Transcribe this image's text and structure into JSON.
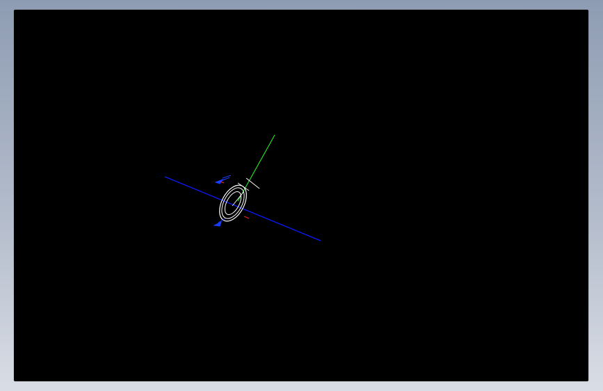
{
  "window": {
    "background_top": "#8e9cb3",
    "background_bottom": "#d9dde5"
  },
  "viewport": {
    "background": "#000000",
    "model": "part",
    "colors": {
      "axis_primary": "#0a1aff",
      "axis_secondary": "#22ff22",
      "geometry": "#ffffff",
      "dimension_arrow": "#1a3cff",
      "hidden_detail": "#ff2222"
    }
  }
}
